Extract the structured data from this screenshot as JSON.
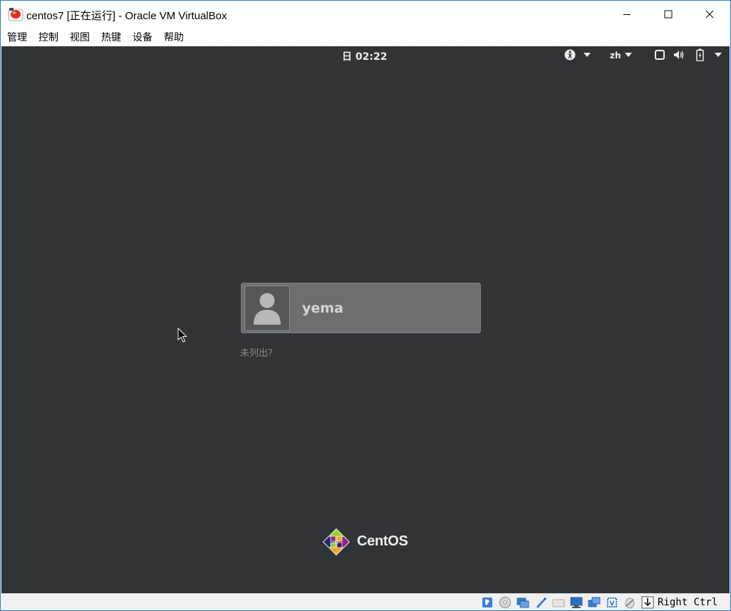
{
  "window": {
    "title": "centos7 [正在运行] - Oracle VM VirtualBox",
    "icon": "virtualbox-vm-icon"
  },
  "menubar": {
    "items": [
      "管理",
      "控制",
      "视图",
      "热键",
      "设备",
      "帮助"
    ]
  },
  "gnome_topbar": {
    "clock": "日 02:22",
    "language": "zh",
    "icons": [
      "accessibility-icon",
      "display-icon",
      "volume-icon",
      "battery-icon"
    ]
  },
  "login": {
    "username": "yema",
    "not_listed": "未列出？"
  },
  "branding": {
    "logo_text": "CentOS"
  },
  "statusbar": {
    "host_key": "Right Ctrl",
    "icons": [
      "hard-disk-icon",
      "optical-drive-icon",
      "audio-icon",
      "network-icon",
      "usb-icon",
      "shared-folder-icon",
      "display-icon",
      "video-capture-icon",
      "cpu-virtualization-icon",
      "mouse-integration-icon",
      "keyboard-capture-icon"
    ]
  },
  "colors": {
    "vm_background": "#2e3436",
    "titlebar_border": "#2b79d0",
    "user_card": "#6c6f70"
  }
}
